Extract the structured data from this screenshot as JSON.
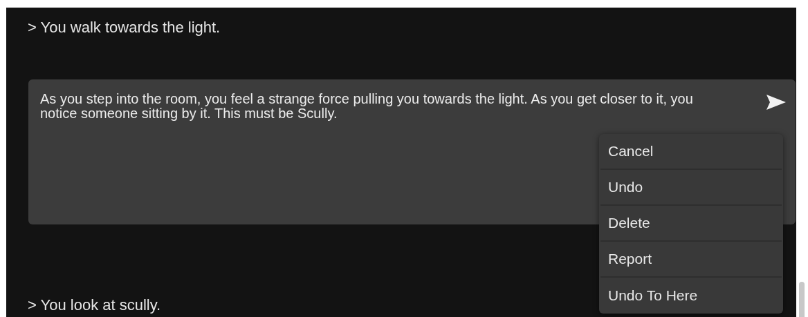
{
  "story": [
    {
      "kind": "action",
      "text": "> You walk towards the light."
    },
    {
      "kind": "editor",
      "text": "As you step into the room, you feel a strange force pulling you towards the light. As you get closer to it, you notice someone sitting by it. This must be Scully."
    },
    {
      "kind": "action",
      "text": "> You look at scully."
    }
  ],
  "context_menu": {
    "items": [
      "Cancel",
      "Undo",
      "Delete",
      "Report",
      "Undo To Here"
    ]
  }
}
